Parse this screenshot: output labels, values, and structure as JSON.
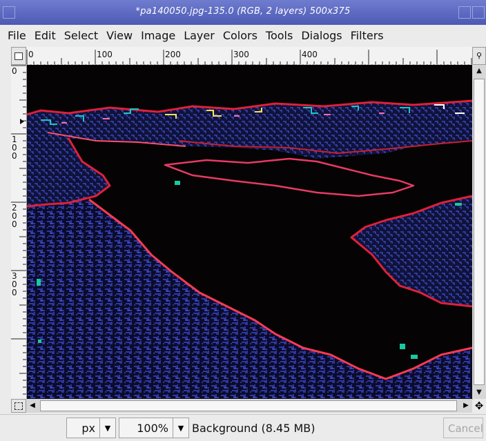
{
  "window": {
    "title": "*pa140050.jpg-135.0 (RGB, 2 layers) 500x375"
  },
  "menubar": {
    "items": [
      "File",
      "Edit",
      "Select",
      "View",
      "Image",
      "Layer",
      "Colors",
      "Tools",
      "Dialogs",
      "Filters"
    ]
  },
  "rulers": {
    "horizontal_labels": [
      "0",
      "100",
      "200",
      "300",
      "400"
    ],
    "vertical_labels": [
      "0",
      "100",
      "200",
      "300"
    ]
  },
  "statusbar": {
    "unit": "px",
    "zoom": "100%",
    "layer_info": "Background (8.45 MB)",
    "cancel_label": "Cancel"
  },
  "icons": {
    "menu_button": "triangle-menu-icon",
    "zoom_toggle": "magnifier-icon",
    "quick_mask": "quick-mask-icon",
    "navigate": "cross-arrows-icon"
  },
  "colors": {
    "title_bar": "#5663c0",
    "canvas_background": "#050303",
    "edge_red": "#e0203a",
    "edge_blue": "#3a46c8"
  }
}
